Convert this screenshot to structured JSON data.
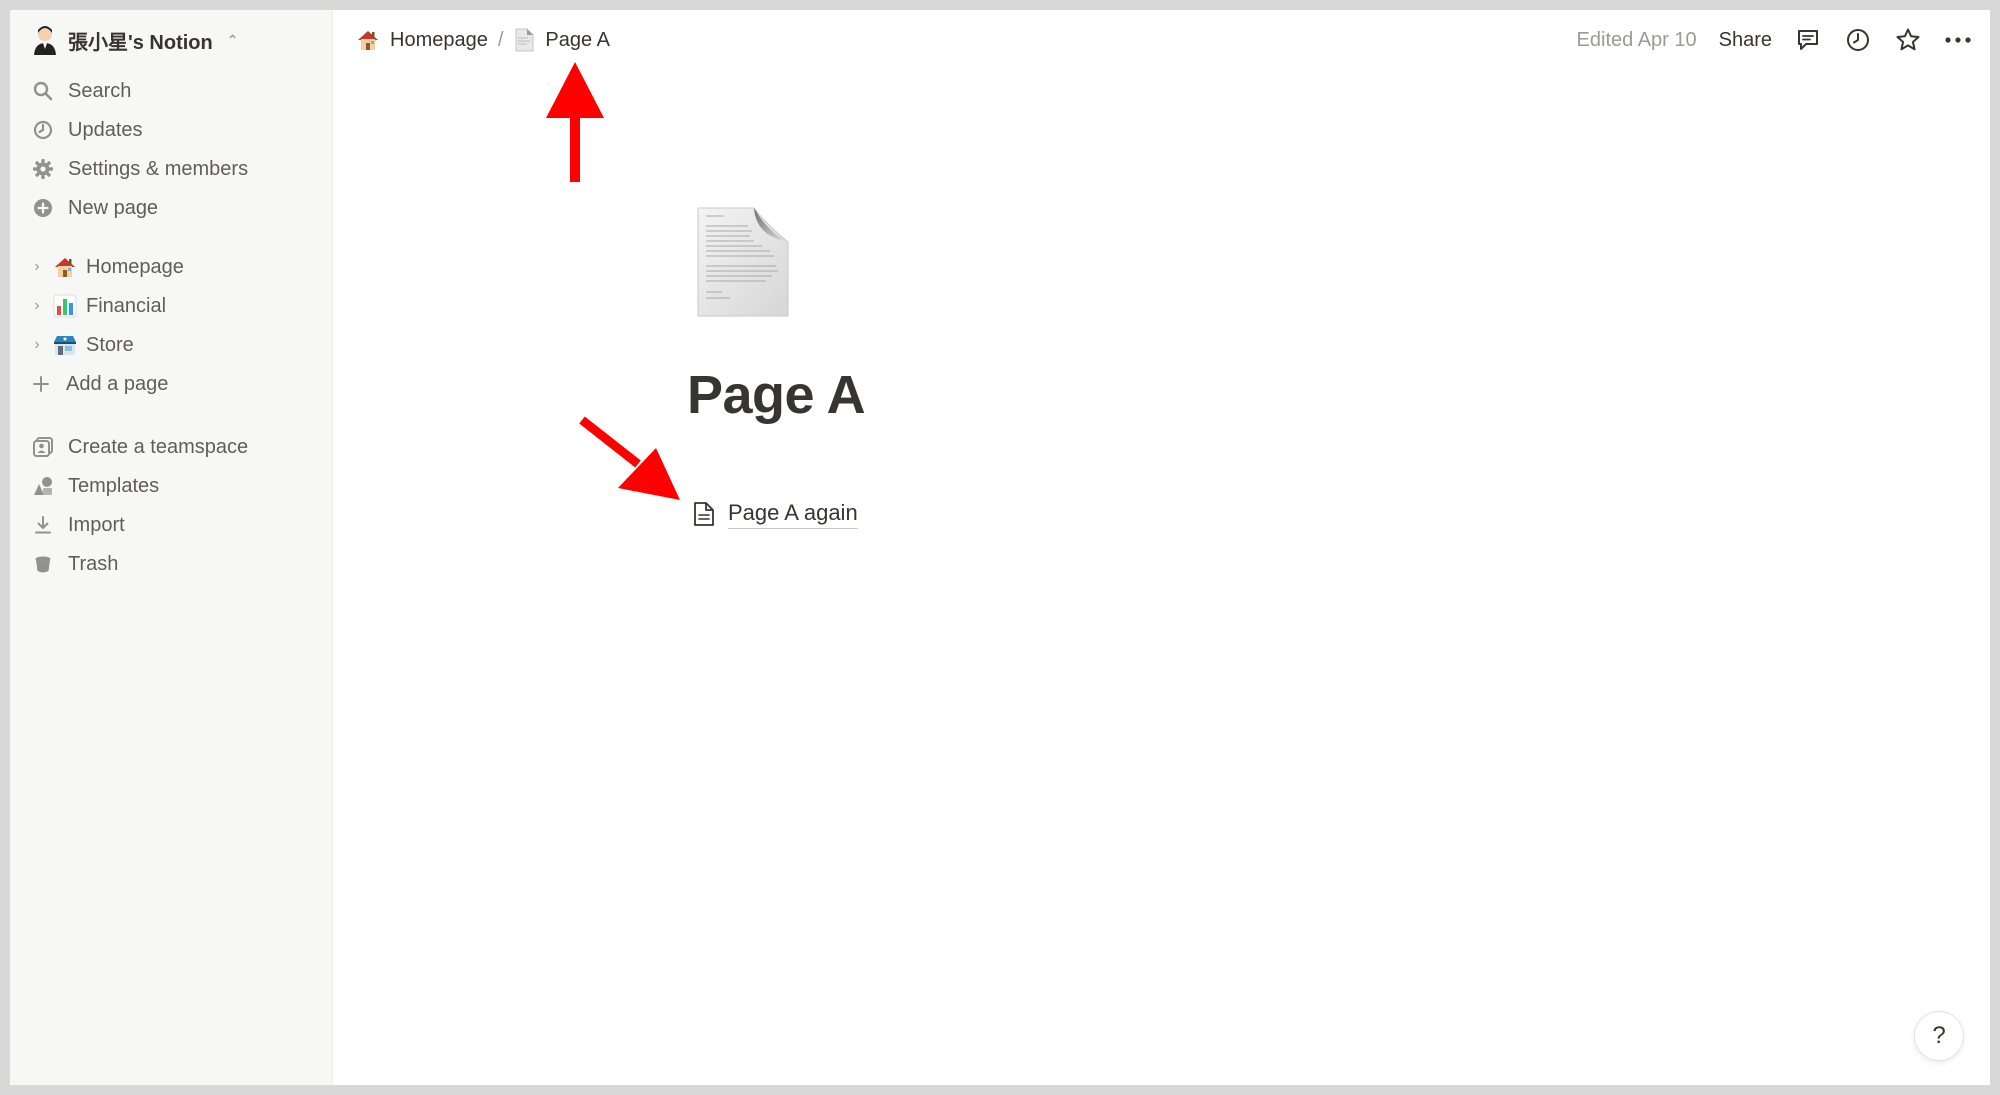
{
  "workspace": {
    "name": "張小星's Notion",
    "switch_icon": "updown-chevron-icon"
  },
  "sidebar": {
    "top_items": [
      {
        "label": "Search",
        "icon": "search-icon"
      },
      {
        "label": "Updates",
        "icon": "clock-icon"
      },
      {
        "label": "Settings & members",
        "icon": "gear-icon"
      },
      {
        "label": "New page",
        "icon": "plus-circle-icon"
      }
    ],
    "pages": [
      {
        "label": "Homepage",
        "icon": "house-emoji"
      },
      {
        "label": "Financial",
        "icon": "bar-chart-emoji"
      },
      {
        "label": "Store",
        "icon": "store-emoji"
      }
    ],
    "add_page": "Add a page",
    "bottom_items": [
      {
        "label": "Create a teamspace",
        "icon": "teamspace-icon"
      },
      {
        "label": "Templates",
        "icon": "templates-icon"
      },
      {
        "label": "Import",
        "icon": "import-icon"
      },
      {
        "label": "Trash",
        "icon": "trash-icon"
      }
    ]
  },
  "breadcrumb": {
    "items": [
      "Homepage",
      "Page A"
    ],
    "separator": "/"
  },
  "topbar": {
    "edited": "Edited Apr 10",
    "share": "Share"
  },
  "page": {
    "title": "Page A",
    "subpage": "Page A again"
  },
  "help": "?",
  "colors": {
    "annotation_arrow": "#ff0000",
    "text": "#37352f",
    "sidebar_bg": "#f7f7f5"
  }
}
